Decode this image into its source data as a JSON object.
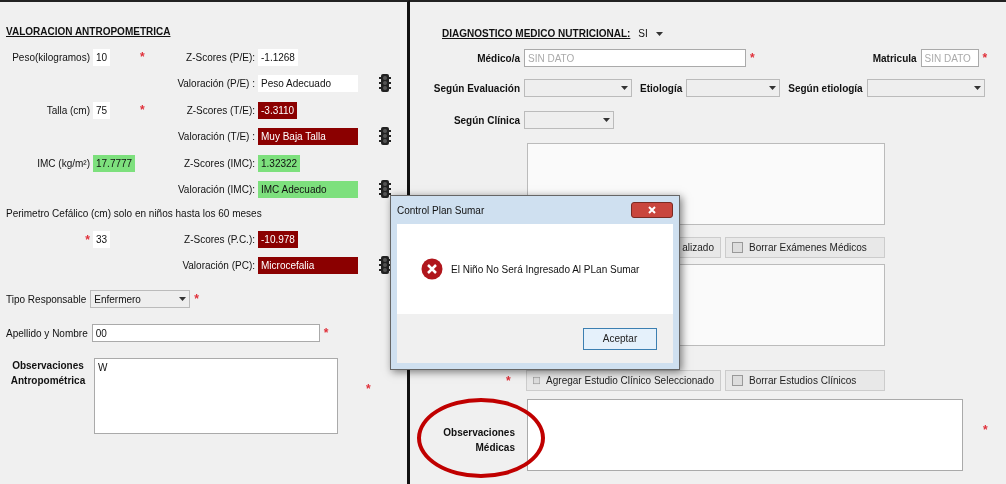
{
  "antropometria": {
    "title": "VALORACION ANTROPOMETRICA",
    "measures": [
      {
        "label": "Peso(kilogramos)",
        "value": {
          "text": "10",
          "color": "#ffffff"
        },
        "mark": "*",
        "z_label": "Z-Scores (P/E):",
        "zscore": {
          "text": "-1.1268",
          "color": "#ffffff"
        },
        "val_label": "Valoración (P/E) :",
        "valoracion": {
          "text": "Peso Adecuado",
          "color": "#ffffff"
        }
      },
      {
        "label": "Talla (cm)",
        "value": {
          "text": "75",
          "color": "#ffffff"
        },
        "mark": "*",
        "z_label": "Z-Scores (T/E):",
        "zscore": {
          "text": "-3.3110",
          "color": "#8b0000"
        },
        "val_label": "Valoración (T/E) :",
        "valoracion": {
          "text": "Muy Baja Talla",
          "color": "#8b0000"
        }
      },
      {
        "label": "IMC (kg/m²)",
        "value": {
          "text": "17.7777",
          "color": "#7de07d"
        },
        "z_label": "Z-Scores (IMC):",
        "zscore": {
          "text": "1.32322",
          "color": "#7de07d"
        },
        "val_label": "Valoración (IMC):",
        "valoracion": {
          "text": "IMC Adecuado",
          "color": "#7de07d"
        }
      },
      {
        "note": "Perimetro Cefálico (cm) solo en niños hasta los 60 meses",
        "value": {
          "text": "33",
          "color": "#ffffff"
        },
        "mark": "*",
        "z_label": "Z-Scores (P.C.):",
        "zscore": {
          "text": "-10.978",
          "color": "#8b0000"
        },
        "val_label": "Valoración (PC):",
        "valoracion": {
          "text": "Microcefalia",
          "color": "#8b0000"
        }
      }
    ],
    "responsable": {
      "label": "Tipo Responsable",
      "value": "Enfermero",
      "mark": "*"
    },
    "nombre": {
      "label": "Apellido y Nombre",
      "value": "00",
      "mark": "*"
    },
    "observaciones": {
      "label": "Observaciones Antropométrica",
      "value": "W",
      "mark": "*"
    }
  },
  "diagnostico": {
    "title": "DIAGNOSTICO MEDICO NUTRICIONAL:",
    "value": "SI",
    "medico": {
      "label": "Médico/a",
      "placeholder": "SIN DATO",
      "mark": "*"
    },
    "matricula": {
      "label": "Matricula",
      "placeholder": "SIN DATO",
      "mark": "*"
    },
    "combos": [
      {
        "label": "Según Evaluación"
      },
      {
        "label": "Etiología"
      },
      {
        "label": "Según etiología"
      }
    ],
    "clinica": {
      "label": "Según Clínica"
    },
    "examen_buttons": [
      "alizado",
      "Borrar Exámenes Médicos"
    ],
    "estudio_buttons": [
      "Agregar Estudio Clínico Seleccionado",
      "Borrar Estudios Clínicos"
    ],
    "estudio_mark": "*",
    "observaciones": {
      "label": "Observaciones Médicas",
      "mark": "*"
    }
  },
  "dialog": {
    "title": "Control Plan Sumar",
    "message": "El Niño No Será Ingresado Al PLan Sumar",
    "button": "Aceptar"
  }
}
